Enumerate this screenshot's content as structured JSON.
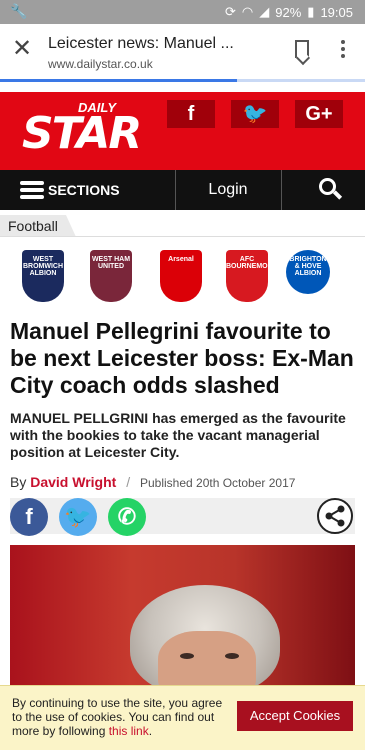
{
  "status_bar": {
    "battery": "92%",
    "time": "19:05"
  },
  "browser": {
    "page_title": "Leicester news: Manuel ...",
    "domain": "www.dailystar.co.uk",
    "load_progress": 0.65
  },
  "masthead": {
    "logo_small": "DAILY",
    "logo_big": "STAR",
    "social": [
      {
        "icon": "facebook-icon",
        "label": "f",
        "name": "facebook"
      },
      {
        "icon": "twitter-icon",
        "label": "🐦",
        "name": "twitter"
      },
      {
        "icon": "google-plus-icon",
        "label": "G+",
        "name": "google-plus"
      }
    ]
  },
  "nav": {
    "sections_label": "SECTIONS",
    "login_label": "Login"
  },
  "section_tab": "Football",
  "crests": [
    {
      "name": "west-brom",
      "label": "WEST BROMWICH ALBION",
      "color": "#1b2a5e"
    },
    {
      "name": "west-ham",
      "label": "WEST HAM UNITED",
      "color": "#7a263a"
    },
    {
      "name": "arsenal",
      "label": "Arsenal",
      "color": "#db0007"
    },
    {
      "name": "bournemouth",
      "label": "AFC BOURNEMOUTH",
      "color": "#d71920"
    },
    {
      "name": "brighton",
      "label": "BRIGHTON & HOVE ALBION",
      "color": "#0057b8"
    }
  ],
  "article": {
    "headline": "Manuel Pellegrini favourite to be next Leicester boss: Ex-Man City coach odds slashed",
    "standfirst": "MANUEL PELLGRINI has emerged as the favourite with the bookies to take the vacant managerial position at Leicester City.",
    "by_prefix": "By",
    "author": "David Wright",
    "separator": "/",
    "published": "Published 20th October 2017"
  },
  "share": [
    {
      "name": "facebook",
      "label": "f",
      "color": "#3b5998"
    },
    {
      "name": "twitter",
      "label": "🐦",
      "color": "#55acee"
    },
    {
      "name": "whatsapp",
      "label": "✆",
      "color": "#25d366"
    }
  ],
  "cookie": {
    "text": "By continuing to use the site, you agree to the use of cookies. You can find out more by following",
    "link": "this link",
    "end": ".",
    "button": "Accept Cookies"
  }
}
